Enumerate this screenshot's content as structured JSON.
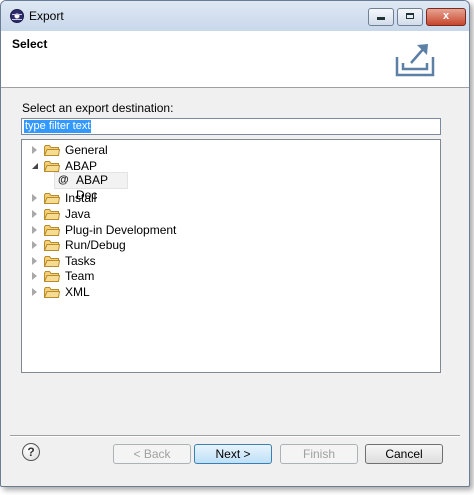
{
  "window": {
    "title": "Export",
    "controls": {
      "minimize": "",
      "maximize": "",
      "close": "x"
    }
  },
  "banner": {
    "title": "Select",
    "icon": "export-wizard-icon"
  },
  "main": {
    "destination_label": "Select an export destination:",
    "filter": {
      "value": "type filter text"
    }
  },
  "tree": {
    "items": [
      {
        "label": "General",
        "expanded": false,
        "icon": "folder-icon"
      },
      {
        "label": "ABAP",
        "expanded": true,
        "icon": "folder-icon"
      },
      {
        "label": "Install",
        "expanded": false,
        "icon": "folder-icon"
      },
      {
        "label": "Java",
        "expanded": false,
        "icon": "folder-icon"
      },
      {
        "label": "Plug-in Development",
        "expanded": false,
        "icon": "folder-icon"
      },
      {
        "label": "Run/Debug",
        "expanded": false,
        "icon": "folder-icon"
      },
      {
        "label": "Tasks",
        "expanded": false,
        "icon": "folder-icon"
      },
      {
        "label": "Team",
        "expanded": false,
        "icon": "folder-icon"
      },
      {
        "label": "XML",
        "expanded": false,
        "icon": "folder-icon"
      }
    ],
    "child": {
      "label": "ABAP Doc",
      "parent": "ABAP",
      "icon": "at-icon",
      "selected": true
    }
  },
  "footer": {
    "help": "?",
    "back_label": "< Back",
    "next_label": "Next >",
    "finish_label": "Finish",
    "cancel_label": "Cancel"
  },
  "colors": {
    "selection": "#3399ff",
    "folder": "#e8b74a",
    "accent": "#3c7fb1"
  }
}
